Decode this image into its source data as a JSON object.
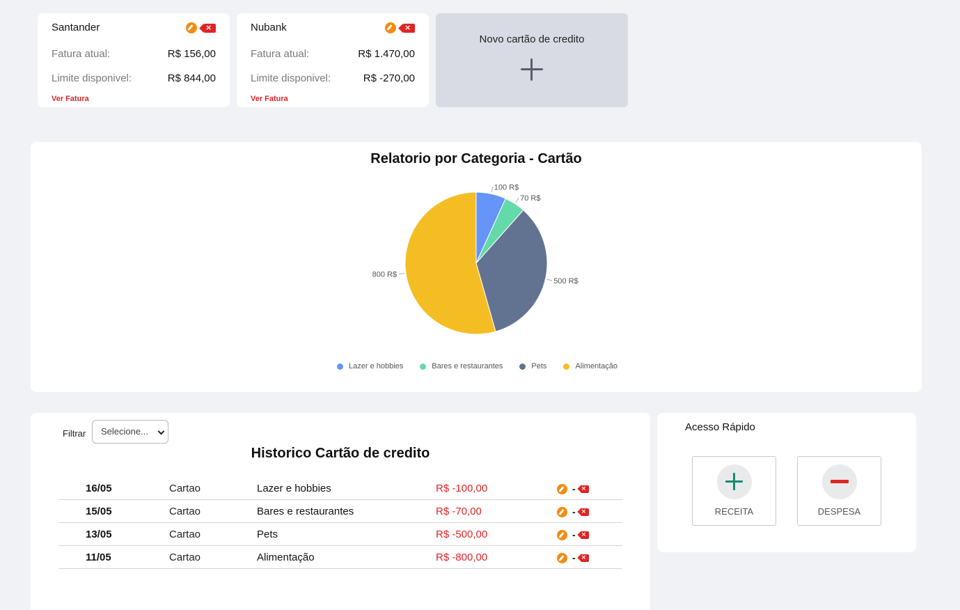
{
  "cards": [
    {
      "name": "Santander",
      "invoice_label": "Fatura atual:",
      "invoice_value": "R$ 156,00",
      "limit_label": "Limite disponivel:",
      "limit_value": "R$ 844,00",
      "link": "Ver Fatura"
    },
    {
      "name": "Nubank",
      "invoice_label": "Fatura atual:",
      "invoice_value": "R$ 1.470,00",
      "limit_label": "Limite disponivel:",
      "limit_value": "R$ -270,00",
      "link": "Ver Fatura"
    }
  ],
  "new_card": {
    "title": "Novo cartão de credito"
  },
  "icons": {
    "edit": "edit-icon",
    "delete": "delete-icon",
    "add": "plus-icon",
    "remove": "minus-icon"
  },
  "colors": {
    "accent_edit": "#f28c13",
    "danger": "#e02424",
    "success": "#178a6f"
  },
  "chart_data": {
    "type": "pie",
    "title": "Relatorio por Categoria - Cartão",
    "categories": [
      "Lazer e hobbies",
      "Bares e restaurantes",
      "Pets",
      "Alimentação"
    ],
    "values": [
      100,
      70,
      500,
      800
    ],
    "data_labels": [
      "100 R$",
      "70 R$",
      "500 R$",
      "800 R$"
    ],
    "colors": [
      "#6595f8",
      "#64d9a9",
      "#627392",
      "#f5bd24"
    ],
    "legend_position": "bottom"
  },
  "history": {
    "filter_label": "Filtrar",
    "filter_value": "Selecione...",
    "title": "Historico Cartão de credito",
    "rows": [
      {
        "date": "16/05",
        "type": "Cartao",
        "category": "Lazer e hobbies",
        "amount": "R$ -100,00"
      },
      {
        "date": "15/05",
        "type": "Cartao",
        "category": "Bares e restaurantes",
        "amount": "R$ -70,00"
      },
      {
        "date": "13/05",
        "type": "Cartao",
        "category": "Pets",
        "amount": "R$ -500,00"
      },
      {
        "date": "11/05",
        "type": "Cartao",
        "category": "Alimentação",
        "amount": "R$ -800,00"
      }
    ],
    "separator": "-"
  },
  "quick_access": {
    "title": "Acesso Rápido",
    "income_label": "RECEITA",
    "expense_label": "DESPESA"
  }
}
